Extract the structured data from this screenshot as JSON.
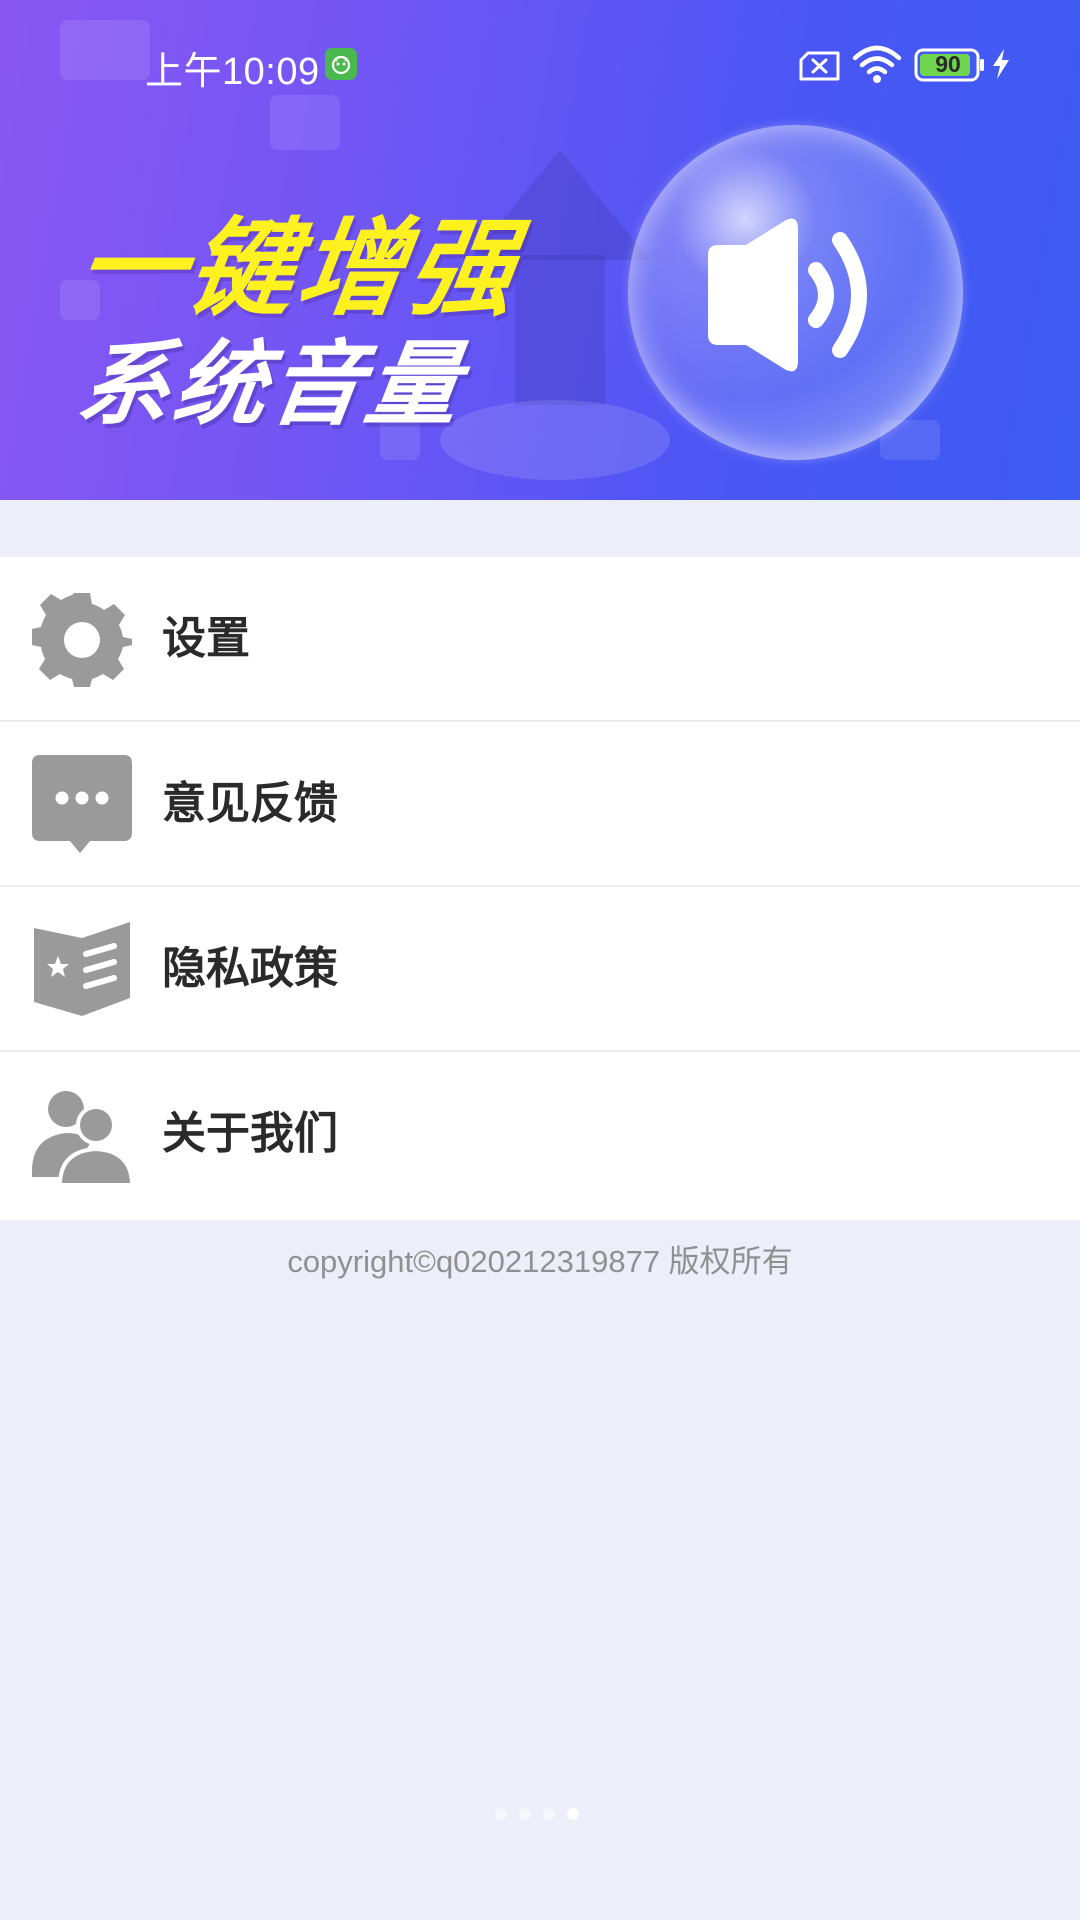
{
  "status_bar": {
    "time": "上午10:09",
    "battery": "90",
    "icons": [
      "app-notification-icon",
      "sim-icon",
      "wifi-icon",
      "battery-icon",
      "charging-icon"
    ]
  },
  "banner": {
    "headline_line1": "一键增强",
    "headline_line2": "系统音量",
    "colors": {
      "headline_accent": "#fdf21f",
      "gradient_start": "#8b57f3",
      "gradient_end": "#3c5cf2"
    },
    "icon": "speaker-volume-icon"
  },
  "menu": {
    "items": [
      {
        "label": "设置",
        "icon": "gear-icon"
      },
      {
        "label": "意见反馈",
        "icon": "feedback-chat-icon"
      },
      {
        "label": "隐私政策",
        "icon": "privacy-book-icon"
      },
      {
        "label": "关于我们",
        "icon": "people-icon"
      }
    ],
    "icon_color": "#9a9a9a"
  },
  "footer": {
    "copyright": "copyright©q020212319877 版权所有"
  },
  "pagination": {
    "count": 4,
    "active_index": 3
  }
}
